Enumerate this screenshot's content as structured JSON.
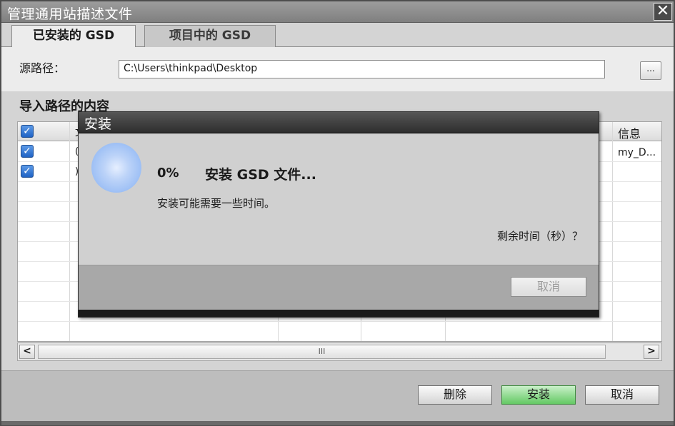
{
  "window": {
    "title": "管理通用站描述文件",
    "close_glyph": "✕"
  },
  "tabs": [
    {
      "label": "已安装的 GSD",
      "active": true
    },
    {
      "label": "项目中的 GSD",
      "active": false
    }
  ],
  "source": {
    "label": "源路径：",
    "path": "C:\\Users\\thinkpad\\Desktop",
    "browse_label": "..."
  },
  "import_section": {
    "title": "导入路径的内容",
    "columns": {
      "info": "信息"
    },
    "rows": [
      {
        "checked": true,
        "fragment": "(",
        "info": "my_D..."
      },
      {
        "checked": true,
        "fragment": ")",
        "info": ""
      }
    ],
    "header_fragment": "文"
  },
  "scrollbar": {
    "left_glyph": "<",
    "right_glyph": ">",
    "thumb_grip": "III"
  },
  "footer": {
    "delete_label": "删除",
    "install_label": "安装",
    "cancel_label": "取消"
  },
  "modal": {
    "title": "安装",
    "percent": "0%",
    "status": "安装 GSD 文件...",
    "note": "安装可能需要一些时间。",
    "remaining": "剩余时间（秒）？",
    "cancel_label": "取消"
  },
  "colors": {
    "install_button": "#64c964",
    "checkbox": "#1f62c4",
    "spinner": "#9ec0f5"
  }
}
